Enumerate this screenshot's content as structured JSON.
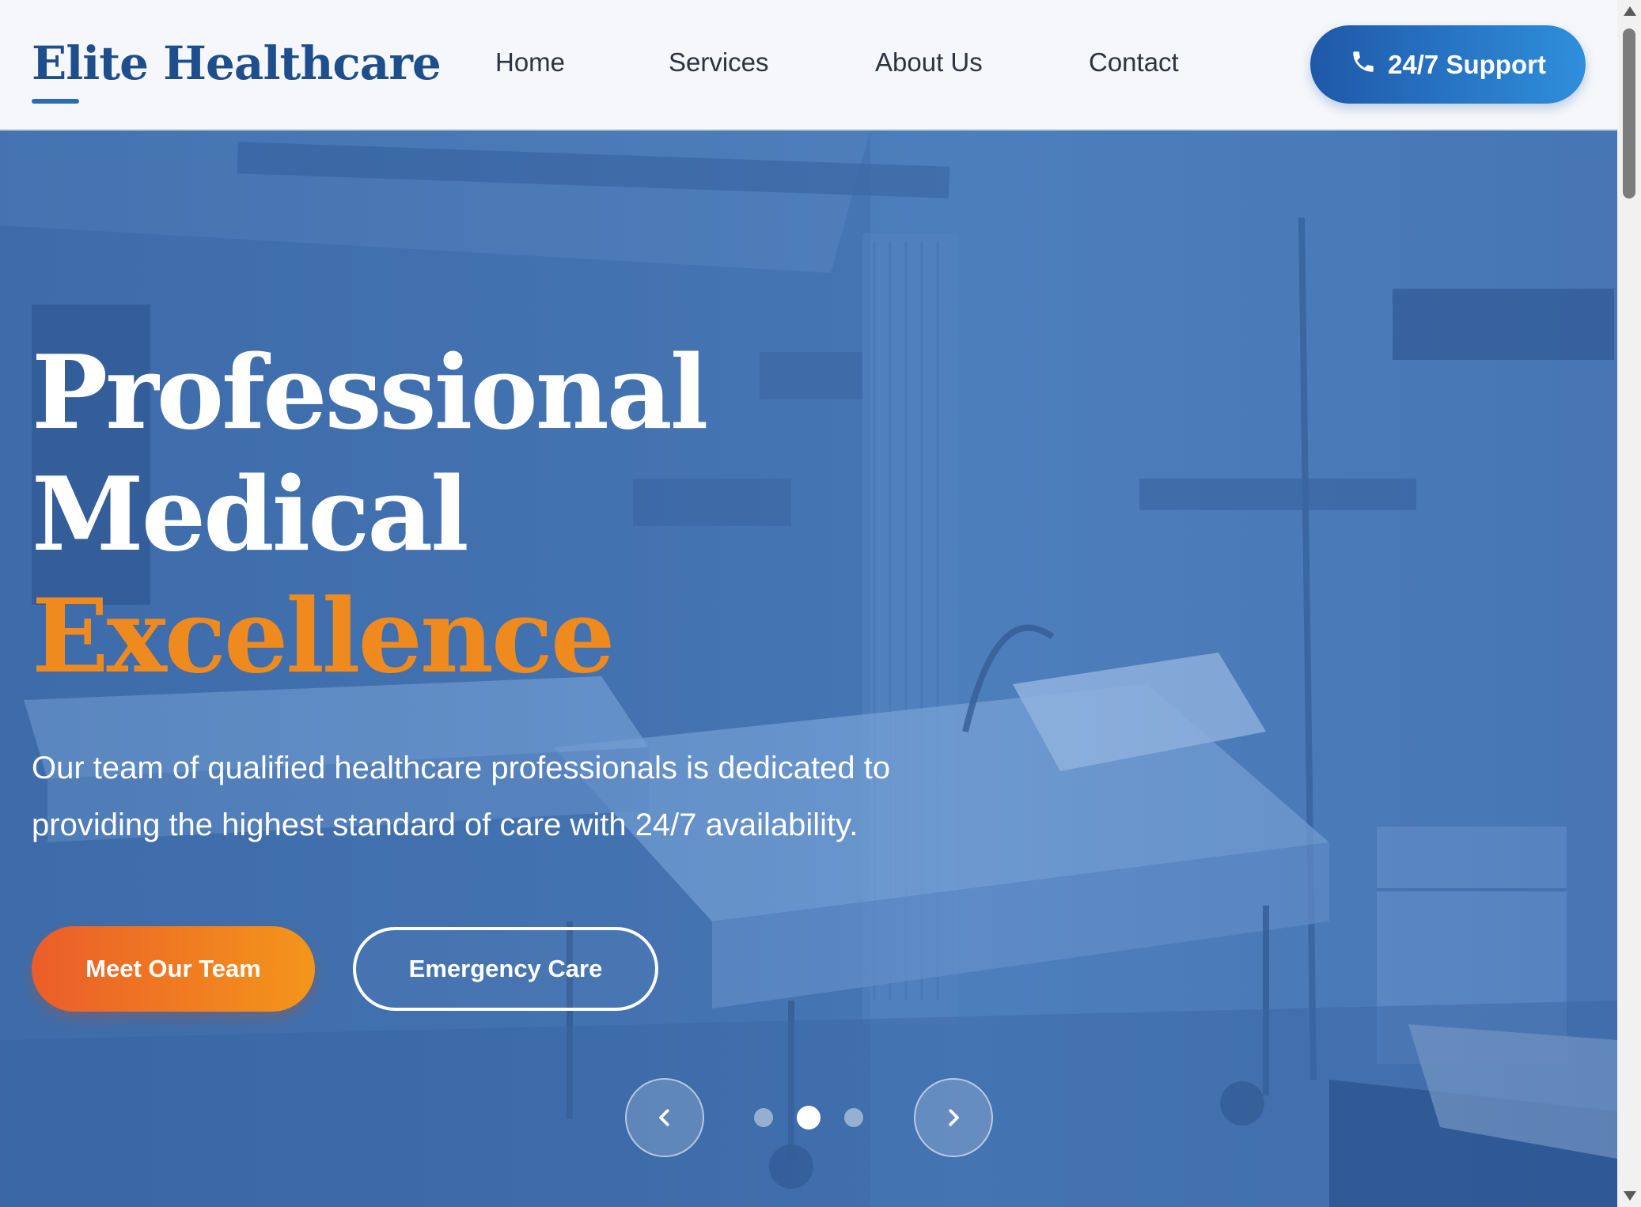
{
  "header": {
    "logo": "Elite Healthcare",
    "nav": [
      {
        "label": "Home"
      },
      {
        "label": "Services"
      },
      {
        "label": "About Us"
      },
      {
        "label": "Contact"
      }
    ],
    "support_button": {
      "label": "24/7 Support",
      "icon": "phone-icon"
    }
  },
  "hero": {
    "headline_line1": "Professional",
    "headline_line2": "Medical",
    "headline_line3": "Excellence",
    "subtext": "Our team of qualified healthcare professionals is dedicated to providing the highest standard of care with 24/7 availability.",
    "primary_button": "Meet Our Team",
    "secondary_button": "Emergency Care",
    "carousel": {
      "prev_icon": "chevron-left-icon",
      "next_icon": "chevron-right-icon",
      "slide_count": 3,
      "active_slide": 2
    }
  },
  "colors": {
    "brand_blue": "#1e4f8c",
    "accent_orange": "#ef8a1f",
    "button_gradient_start": "#ea5d2a",
    "button_gradient_end": "#f4961a"
  }
}
